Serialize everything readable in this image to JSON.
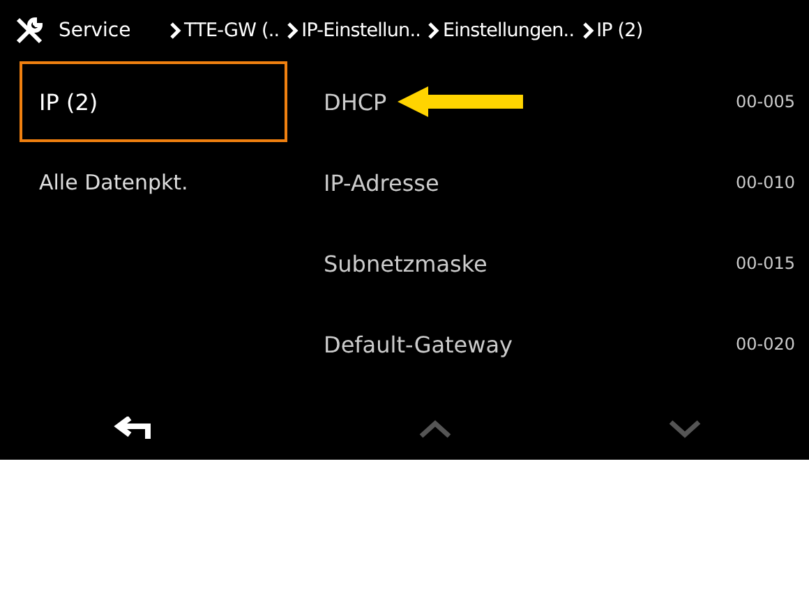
{
  "header": {
    "title": "Service",
    "breadcrumbs": [
      "TTE-GW (..",
      "IP-Einstellun..",
      "Einstellungen..",
      "IP (2)"
    ]
  },
  "sidebar": {
    "items": [
      {
        "label": "IP (2)",
        "selected": true
      },
      {
        "label": "Alle Datenpkt.",
        "selected": false
      }
    ]
  },
  "list": {
    "rows": [
      {
        "label": "DHCP",
        "code": "00-005",
        "annotated": true
      },
      {
        "label": "IP-Adresse",
        "code": "00-010",
        "annotated": false
      },
      {
        "label": "Subnetzmaske",
        "code": "00-015",
        "annotated": false
      },
      {
        "label": "Default-Gateway",
        "code": "00-020",
        "annotated": false
      }
    ]
  },
  "footer": {
    "buttons": [
      {
        "kind": "back",
        "disabled": false
      },
      {
        "kind": "up",
        "disabled": true
      },
      {
        "kind": "down",
        "disabled": true
      }
    ]
  }
}
